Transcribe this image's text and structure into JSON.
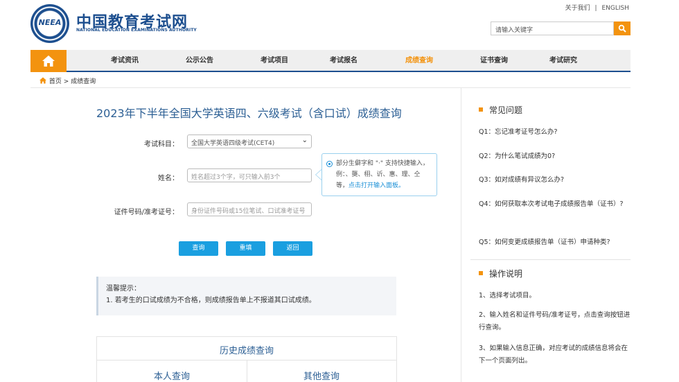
{
  "header": {
    "logo_cn": "中国教育考试网",
    "logo_en": "NATIONAL EDUCATION EXAMINATIONS AUTHORITY",
    "logo_badge": "NEEA",
    "about_link": "关于我们",
    "english_link": "ENGLISH",
    "search_placeholder": "请输入关键字"
  },
  "nav": {
    "items": [
      {
        "label": "考试资讯"
      },
      {
        "label": "公示公告"
      },
      {
        "label": "考试项目"
      },
      {
        "label": "考试报名"
      },
      {
        "label": "成绩查询"
      },
      {
        "label": "证书查询"
      },
      {
        "label": "考试研究"
      }
    ],
    "active_index": 4
  },
  "breadcrumb": {
    "home": "首页",
    "separator": ">",
    "current": "成绩查询"
  },
  "main": {
    "title": "2023年下半年全国大学英语四、六级考试（含口试）成绩查询",
    "form": {
      "subject_label": "考试科目：",
      "subject_value": "全国大学英语四级考试(CET4)",
      "name_label": "姓名：",
      "name_placeholder": "姓名超过3个字，可只输入前3个",
      "id_label": "证件号码/准考证号：",
      "id_placeholder": "身份证件号码或15位笔试、口试准考证号"
    },
    "tip": {
      "text": "部分生僻字和 \"·\" 支持快捷输入，例：、龑、栩、䜣、惠、理、仝等，",
      "link": "点击打开输入面板。"
    },
    "buttons": {
      "query": "查询",
      "reset": "重填",
      "back": "返回"
    },
    "notice": {
      "title": "温馨提示：",
      "line1": "1. 若考生的口试成绩为不合格，则成绩报告单上不报道其口试成绩。"
    },
    "history": {
      "title": "历史成绩查询",
      "tab_self": "本人查询",
      "tab_other": "其他查询"
    }
  },
  "sidebar": {
    "faq_title": "常见问题",
    "faqs": [
      "Q1：忘记准考证号怎么办?",
      "Q2：为什么笔试成绩为0?",
      "Q3：如对成绩有异议怎么办?",
      "Q4：如何获取本次考试电子成绩报告单（证书）?",
      "Q5：如何变更成绩报告单（证书）申请种类?"
    ],
    "ops_title": "操作说明",
    "ops": [
      "1、选择考试项目。",
      "2、输入姓名和证件号码/准考证号，点击查询按钮进行查询。",
      "3、如果输入信息正确，对应考试的成绩信息将会在下一个页面列出。"
    ]
  },
  "colors": {
    "brand_blue": "#1d4f8f",
    "accent_orange": "#f3930f",
    "button_blue": "#1a9fe0"
  }
}
